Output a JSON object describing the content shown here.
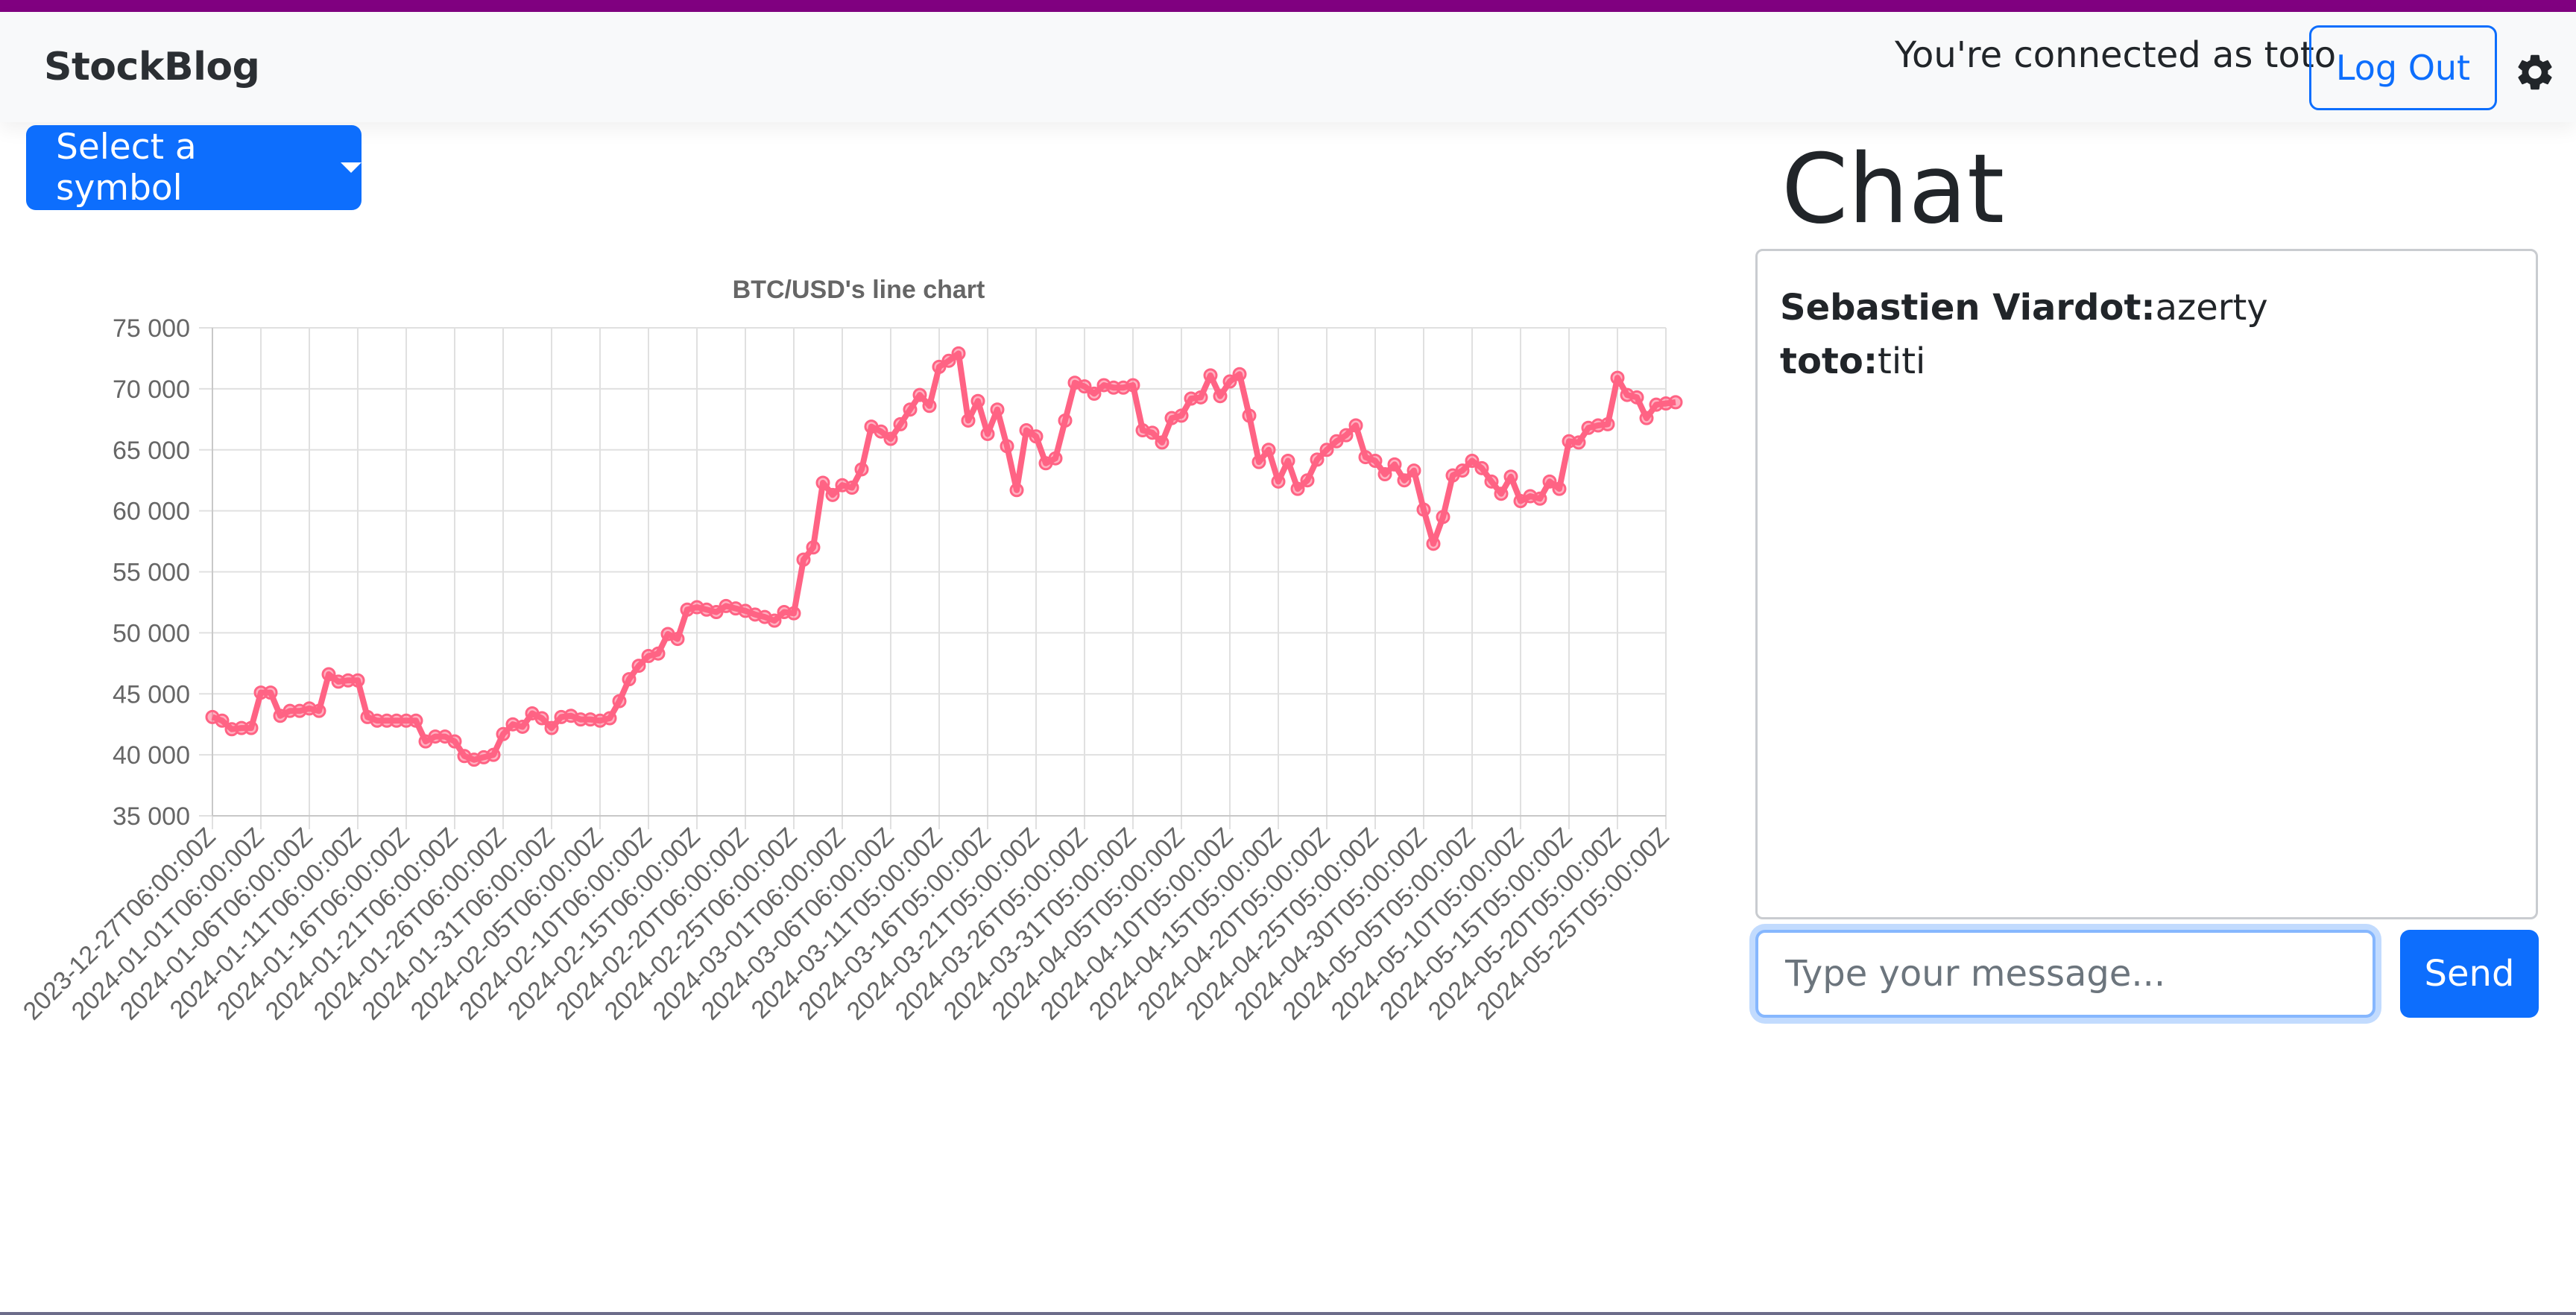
{
  "navbar": {
    "brand": "StockBlog",
    "connected_text": "You're connected as toto",
    "logout_label": "Log Out",
    "settings_icon": "gear-icon"
  },
  "symbol_dropdown": {
    "label": "Select a symbol"
  },
  "chat": {
    "title": "Chat",
    "messages": [
      {
        "author": "Sebastien Viardot:",
        "text": "azerty"
      },
      {
        "author": "toto:",
        "text": "titi"
      }
    ],
    "input_placeholder": "Type your message...",
    "send_label": "Send"
  },
  "colors": {
    "accent": "#0d6efd",
    "top_stripe": "#800080",
    "line": "#ff6384"
  },
  "chart_data": {
    "type": "line",
    "title": "BTC/USD's line chart",
    "ylim": [
      35000,
      75000
    ],
    "yticks": [
      75000,
      70000,
      65000,
      60000,
      55000,
      50000,
      45000,
      40000,
      35000
    ],
    "ytick_labels": [
      "75 000",
      "70 000",
      "65 000",
      "60 000",
      "55 000",
      "50 000",
      "45 000",
      "40 000",
      "35 000"
    ],
    "xtick_labels": [
      "2023-12-27T06:00:00Z",
      "2024-01-01T06:00:00Z",
      "2024-01-06T06:00:00Z",
      "2024-01-11T06:00:00Z",
      "2024-01-16T06:00:00Z",
      "2024-01-21T06:00:00Z",
      "2024-01-26T06:00:00Z",
      "2024-01-31T06:00:00Z",
      "2024-02-05T06:00:00Z",
      "2024-02-10T06:00:00Z",
      "2024-02-15T06:00:00Z",
      "2024-02-20T06:00:00Z",
      "2024-02-25T06:00:00Z",
      "2024-03-01T06:00:00Z",
      "2024-03-06T06:00:00Z",
      "2024-03-11T05:00:00Z",
      "2024-03-16T05:00:00Z",
      "2024-03-21T05:00:00Z",
      "2024-03-26T05:00:00Z",
      "2024-03-31T05:00:00Z",
      "2024-04-05T05:00:00Z",
      "2024-04-10T05:00:00Z",
      "2024-04-15T05:00:00Z",
      "2024-04-20T05:00:00Z",
      "2024-04-25T05:00:00Z",
      "2024-04-30T05:00:00Z",
      "2024-05-05T05:00:00Z",
      "2024-05-10T05:00:00Z",
      "2024-05-15T05:00:00Z",
      "2024-05-20T05:00:00Z",
      "2024-05-25T05:00:00Z"
    ],
    "points_per_tick": 5,
    "values": [
      43100,
      42800,
      42100,
      42200,
      42200,
      45100,
      45100,
      43200,
      43600,
      43600,
      43800,
      43600,
      46600,
      46000,
      46100,
      46100,
      43100,
      42800,
      42800,
      42800,
      42800,
      42800,
      41100,
      41500,
      41500,
      41100,
      39900,
      39600,
      39800,
      40000,
      41700,
      42500,
      42300,
      43400,
      43000,
      42200,
      43100,
      43200,
      42900,
      42900,
      42800,
      43000,
      44400,
      46200,
      47300,
      48100,
      48300,
      49900,
      49500,
      51900,
      52100,
      51900,
      51700,
      52200,
      52000,
      51800,
      51500,
      51300,
      51000,
      51700,
      51600,
      56000,
      57000,
      62300,
      61300,
      62100,
      61900,
      63400,
      66900,
      66500,
      65900,
      67100,
      68300,
      69500,
      68600,
      71800,
      72300,
      72900,
      67400,
      69000,
      66300,
      68300,
      65300,
      61700,
      66600,
      66100,
      63900,
      64300,
      67400,
      70500,
      70200,
      69600,
      70300,
      70100,
      70100,
      70300,
      66600,
      66400,
      65600,
      67600,
      67800,
      69200,
      69300,
      71100,
      69400,
      70600,
      71200,
      67800,
      64000,
      65000,
      62400,
      64100,
      61800,
      62500,
      64200,
      65000,
      65700,
      66200,
      67000,
      64400,
      64100,
      63000,
      63800,
      62500,
      63300,
      60100,
      57300,
      59500,
      62900,
      63300,
      64100,
      63500,
      62400,
      61400,
      62800,
      60800,
      61200,
      61000,
      62400,
      61800,
      65700,
      65600,
      66800,
      67000,
      67100,
      70900,
      69500,
      69300,
      67600,
      68700,
      68800,
      68900
    ]
  }
}
